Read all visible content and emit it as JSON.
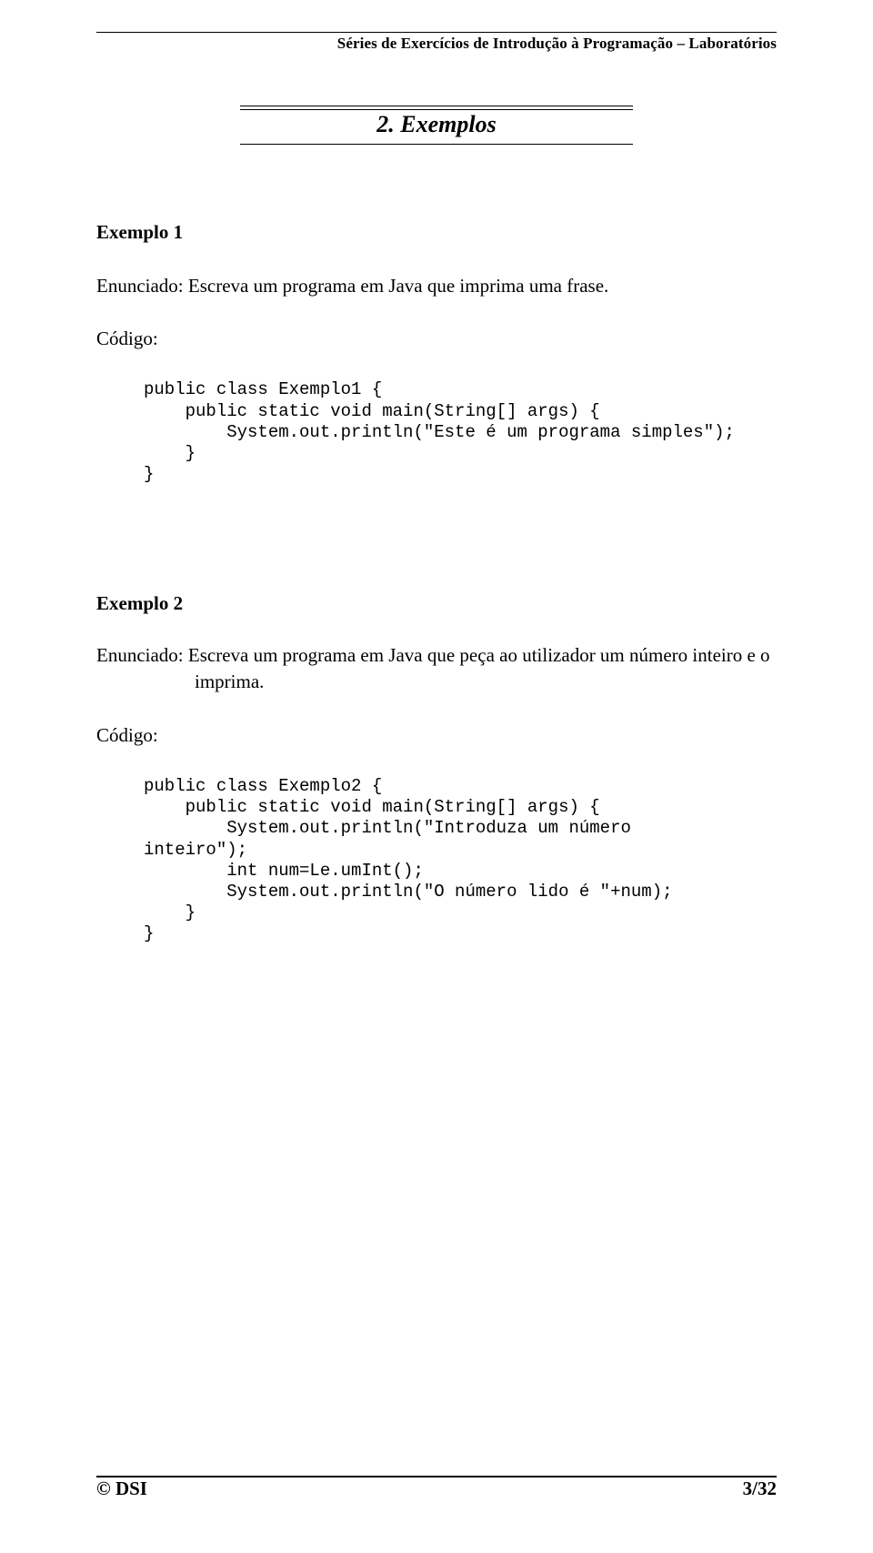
{
  "header": {
    "title": "Séries de Exercícios de Introdução à Programação – Laboratórios"
  },
  "section": {
    "heading": "2. Exemplos"
  },
  "example1": {
    "title": "Exemplo 1",
    "enunciado": "Enunciado: Escreva um programa em Java que imprima uma frase.",
    "codigo_label": "Código:",
    "code": "public class Exemplo1 {\n    public static void main(String[] args) {\n        System.out.println(\"Este é um programa simples\");\n    }\n}"
  },
  "example2": {
    "title": "Exemplo 2",
    "enunciado_line1": "Enunciado: Escreva um programa em Java que peça ao utilizador um número inteiro e o",
    "enunciado_line2": "imprima.",
    "codigo_label": "Código:",
    "code": "public class Exemplo2 {\n    public static void main(String[] args) {\n        System.out.println(\"Introduza um número\ninteiro\");\n        int num=Le.umInt();\n        System.out.println(\"O número lido é \"+num);\n    }\n}"
  },
  "footer": {
    "left": "© DSI",
    "right": "3/32"
  }
}
